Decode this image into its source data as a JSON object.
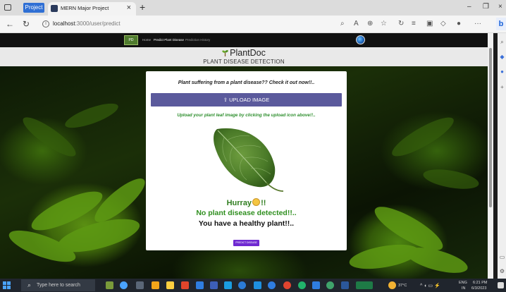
{
  "browser": {
    "profile_label": "Project",
    "tab_title": "MERN Major Project",
    "tab_close": "×",
    "new_tab": "+",
    "url_host": "localhost",
    "url_path": ":3000/user/predict",
    "window_controls": [
      "–",
      "❐",
      "×"
    ]
  },
  "site_nav": {
    "logo_text": "PD",
    "links": [
      "Home",
      "Predict Plant Disease",
      "Prediction History"
    ]
  },
  "brand": {
    "title": "PlantDoc",
    "subtitle": "PLANT DISEASE DETECTION"
  },
  "card": {
    "prompt": "Plant suffering from a plant disease?? Check it out now!!..",
    "upload_label": "⇧ UPLOAD IMAGE",
    "hint": "Upload your plant leaf image by clicking the upload icon above!!..",
    "hurray_prefix": "Hurray",
    "hurray_suffix": "!!",
    "status": "No plant disease detected!!..",
    "healthy": "You have a healthy plant!!..",
    "predict_label": "PREDICT DISEASE"
  },
  "taskbar": {
    "search_placeholder": "Type here to search",
    "temperature": "37°C",
    "language": "ENG",
    "region": "IN",
    "time": "6:21 PM",
    "date": "6/3/2023"
  },
  "colors": {
    "upload_button": "#5b5a9c",
    "predict_button": "#6f2ad1",
    "success_green": "#2f8f1f",
    "profile_blue": "#2f6fd4"
  }
}
